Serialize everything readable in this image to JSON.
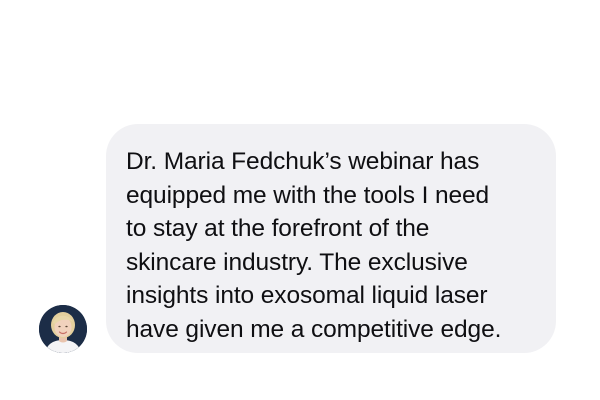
{
  "message": {
    "lines": [
      "Dr. Maria Fedchuk’s webinar has",
      "equipped me with the tools I need",
      "to stay at the forefront of the",
      "skincare industry. The exclusive",
      "insights into exosomal liquid laser",
      "have given me a competitive edge."
    ]
  },
  "colors": {
    "bubble_background": "#f1f1f4",
    "text": "#0f0f12",
    "page_background": "#ffffff"
  },
  "icons": {
    "avatar": "user-avatar-photo"
  }
}
